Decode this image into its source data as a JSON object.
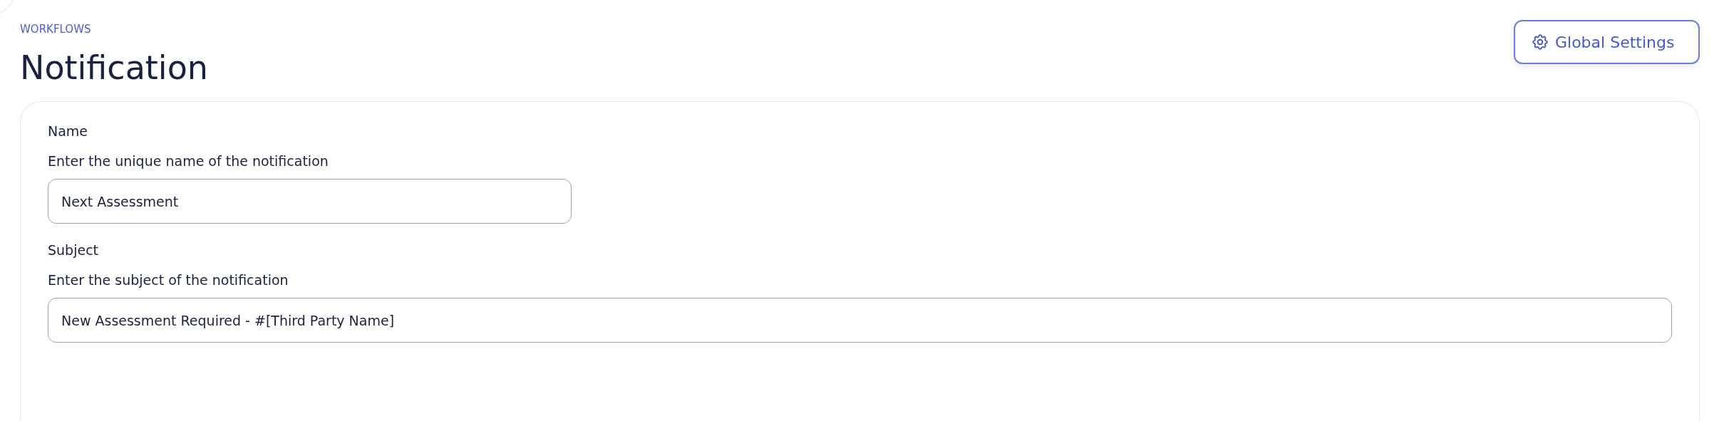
{
  "breadcrumb": "WORKFLOWS",
  "title": "Notification",
  "settings_button": {
    "label": "Global Settings"
  },
  "fields": [
    {
      "kind": "short",
      "label": "Name",
      "description": "Enter the unique name of the notification",
      "value": "Next Assessment"
    },
    {
      "kind": "full",
      "label": "Subject",
      "description": "Enter the subject of the notification",
      "value": "New Assessment Required - #[Third Party Name]"
    }
  ]
}
